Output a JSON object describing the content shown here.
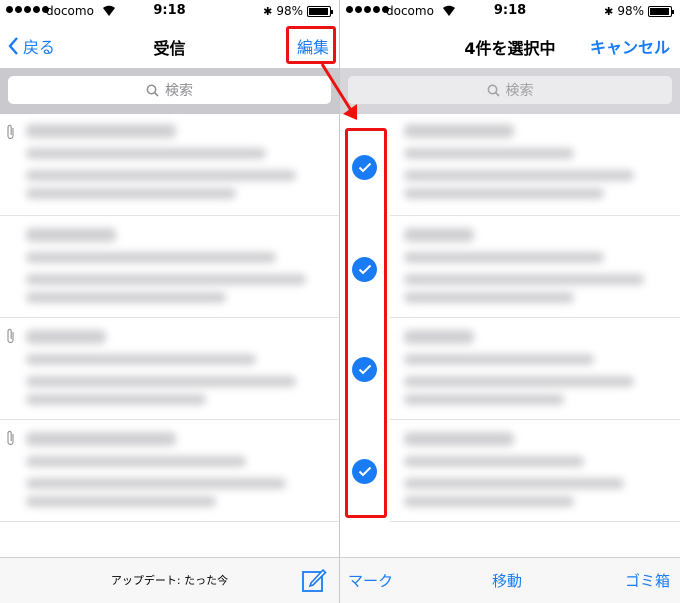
{
  "status": {
    "carrier": "docomo",
    "time": "9:18",
    "battery": "98%"
  },
  "left": {
    "back_label": "戻る",
    "title": "受信",
    "edit_label": "編集",
    "search_placeholder": "検索",
    "update_text": "アップデート: たった今"
  },
  "right": {
    "title": "4件を選択中",
    "cancel_label": "キャンセル",
    "search_placeholder": "検索",
    "toolbar": {
      "mark": "マーク",
      "move": "移動",
      "trash": "ゴミ箱"
    }
  },
  "colors": {
    "accent": "#1a7cf5",
    "highlight": "#e11111"
  },
  "icons": [
    "search-icon",
    "wifi-icon",
    "battery-icon",
    "attachment-icon",
    "compose-icon",
    "checkmark-icon"
  ]
}
